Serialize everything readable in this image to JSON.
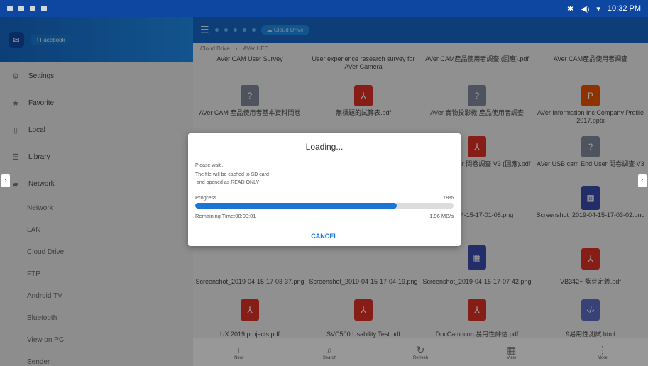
{
  "status_bar": {
    "time": "10:32 PM"
  },
  "sidebar": {
    "account_label": "Facebook",
    "items": [
      {
        "label": "Settings",
        "icon": "gear-icon"
      },
      {
        "label": "Favorite",
        "icon": "star-icon"
      },
      {
        "label": "Local",
        "icon": "phone-icon"
      },
      {
        "label": "Library",
        "icon": "library-icon"
      },
      {
        "label": "Network",
        "icon": "network-icon"
      }
    ],
    "sub_items": [
      "Network",
      "LAN",
      "Cloud Drive",
      "FTP",
      "Android TV",
      "Bluetooth",
      "View on PC",
      "Sender"
    ]
  },
  "toolbar": {
    "location": "Cloud Drive"
  },
  "breadcrumb": [
    "Cloud Drive",
    "AVer UEC"
  ],
  "files": [
    {
      "name": "AVer CAM User Survey"
    },
    {
      "name": "User experience research survey for AVer Camera"
    },
    {
      "name": "AVer CAM產品使用者調查 (回應).pdf"
    },
    {
      "name": "AVer CAM產品使用者調查"
    },
    {
      "name": "AVer CAM 產品使用者基本資料問卷"
    },
    {
      "name": "無標題的試算表.pdf"
    },
    {
      "name": "AVer 實物投影機 產品使用者調查"
    },
    {
      "name": "AVer Information Inc Company Profile 2017.pptx"
    },
    {
      "name": "cam End User 問卷調查 V3 (回應).pdf"
    },
    {
      "name": "AVer USB cam End User 問卷調查 V3"
    },
    {
      "name": "2019-04-15-17-01-08.png"
    },
    {
      "name": "Screenshot_2019-04-15-17-03-02.png"
    },
    {
      "name": "Screenshot_2019-04-15-17-03-37.png"
    },
    {
      "name": "Screenshot_2019-04-15-17-04-19.png"
    },
    {
      "name": "Screenshot_2019-04-15-17-07-42.png"
    },
    {
      "name": "VB342+ 藍芽定義.pdf"
    },
    {
      "name": "UX 2019 projects.pdf"
    },
    {
      "name": "SVC500 Usability Test.pdf"
    },
    {
      "name": "DocCam icon 易用性評估.pdf"
    },
    {
      "name": "9易用性測試.html"
    }
  ],
  "bottom_bar": [
    {
      "label": "New",
      "icon": "plus-icon"
    },
    {
      "label": "Search",
      "icon": "search-icon"
    },
    {
      "label": "Refresh",
      "icon": "refresh-icon"
    },
    {
      "label": "View",
      "icon": "grid-view-icon"
    },
    {
      "label": "More",
      "icon": "more-icon"
    }
  ],
  "dialog": {
    "title": "Loading...",
    "line1": "Please wait...",
    "line2": "The file will be cached to SD card",
    "line3": " and opened as READ ONLY",
    "progress_label": "Progress",
    "progress_text": "78%",
    "progress_value": 0.78,
    "remaining": "Remaining Time:00:00:01",
    "speed": "1.96 MB/s",
    "cancel": "CANCEL"
  },
  "colors": {
    "accent": "#1976d2",
    "toolbar": "#1565c0",
    "pdf": "#d93025"
  }
}
